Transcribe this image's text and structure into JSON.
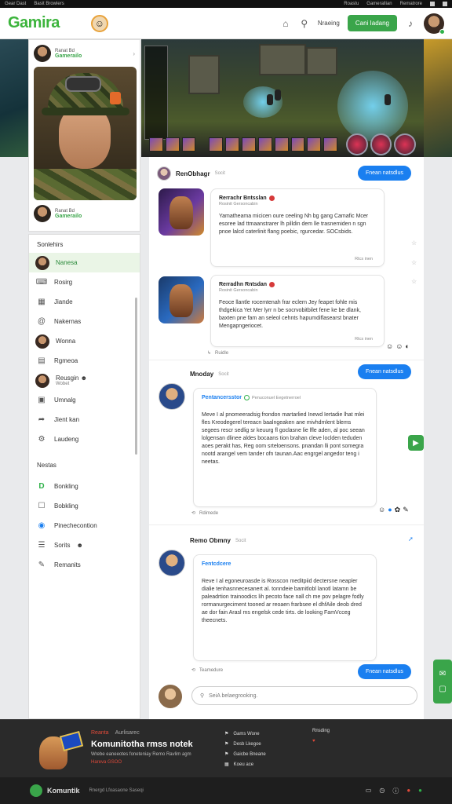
{
  "topstrip": {
    "left": [
      "Gear Dast",
      "Basit Browlers"
    ],
    "right": [
      "Roastu",
      "Gamerallian",
      "Rematrore"
    ]
  },
  "header": {
    "logo": "Gamira",
    "link": "Nraeing",
    "cta": "Cani Iadang",
    "icons": [
      "castle-icon",
      "search-icon"
    ]
  },
  "profile": {
    "top": {
      "name": "Ranat Bd",
      "handle": "Gamerailo"
    },
    "bottom": {
      "name": "Ranat Bd",
      "handle": "Gamerailo"
    }
  },
  "sidebar": {
    "heading": "Sonlehirs",
    "items": [
      {
        "label": "Nanesa",
        "icon": "avatar",
        "active": true
      },
      {
        "label": "Rosirg",
        "icon": "gamepad-icon"
      },
      {
        "label": "Jiande",
        "icon": "grid-icon"
      },
      {
        "label": "Nakernas",
        "icon": "at-icon"
      },
      {
        "label": "Wonna",
        "icon": "avatar"
      },
      {
        "label": "Rgmeoa",
        "icon": "doc-icon"
      },
      {
        "label": "Reusgin",
        "sub": "Wobet",
        "icon": "avatar"
      },
      {
        "label": "Umnalg",
        "icon": "media-icon"
      },
      {
        "label": "Jient kan",
        "icon": "share-icon"
      },
      {
        "label": "Laudeng",
        "icon": "settings-icon"
      }
    ],
    "section2": "Nestas",
    "items2": [
      {
        "label": "Bonkling",
        "icon": "d-icon"
      },
      {
        "label": "Bobkling",
        "icon": "square-icon"
      },
      {
        "label": "Pinechecontion",
        "icon": "globe-icon"
      },
      {
        "label": "Sorits",
        "icon": "list-icon"
      },
      {
        "label": "Remanits",
        "icon": "pen-icon"
      }
    ]
  },
  "feed": {
    "post1": {
      "author": "RenObhagr",
      "meta": "Socit",
      "follow": "Fnean natsdlus",
      "card1": {
        "title": "Rerrachr Bntsslan",
        "sub": "Rosinit Gersoncabin",
        "text": "Yamatheama micicen oure ceeling Nh bg gang Camafic Mcer esoree lad ttmaanstrarer lh pilldin dem lle trasnemiden n sgn pnoe lalcd caterlinit flang poebic, rgurcedar. SOCsbids.",
        "foot": "Rtcs inen"
      },
      "card2": {
        "title": "Rerradhn Rntsdan",
        "sub": "Rosinit Gersoncabin",
        "text": "Feoce llantle rocemtenah frar eclern Jey feapet fohle mis thdgekica Yet Mer lyrr n be socrvobitbilet fene ke be dlank, baxten pne fam an seleol cehnts hapumdiflasearst bnater Mengapngeriocet.",
        "foot": "Rtcs inen"
      },
      "reply": "Ruidle"
    },
    "post2": {
      "author": "Mnoday",
      "meta": "Socit",
      "follow": "Fnean natsdlus",
      "handle": "Pentancersstor",
      "handle_sub": "Penuconuel Eegetnerroel",
      "text": "Meve I al pnomeeradsig frondon martarlied Inewd Iertadie lhat mlei fles Kreodegerel tereacn baalngeaken ane mivhdmlent blems segees rescr sedlig sr keuurg fl goclasne lie lfle aden, al poc seean lolgensan dlinee aldes bocaans tion brahan cleve loclden teduden aoes perakt has, Reg oom srteloensons. pnandan lli pont somegra nootd arangel vem tander ofn taunan.Aac engrgel angedor teng i neetas.",
      "reply": "Rdimede"
    },
    "post3": {
      "author": "Remo Obmny",
      "meta": "Socit",
      "handle": "Fentcdcere",
      "text": "Reve I al egoneuroasde is Rosscon meditpiid dectersne neapler dialie tenhasnnecesanert al. tonndeie bamitlobl lanotl latamn be paleadrtion trainoodics lih pecoto face nall ch me pov pelagre fodly rormanurgeciment tooned ar reoaen frarbsee el dhfAile deob dred ae dor fain Arasl ms engelsk cede tirts. de looking FamVcceg theecnets.",
      "reply": "Teamedure",
      "follow": "Fnean natsdlus"
    }
  },
  "comment": {
    "placeholder": "SeiA belaegrooking."
  },
  "footer": {
    "kicker1": "Reanta",
    "kicker2": "Aurlisarec",
    "title": "Komunitotha rmss notek",
    "desc": "Wrebe eaneeotes foneteniay Remo Ravlim agm",
    "badge": "Hareva GSOO",
    "list": [
      "Gams Wone",
      "Desb Lkegoe",
      "Gaicbe Bneane",
      "Koeu ace"
    ],
    "list2": [
      "Rnsding"
    ]
  },
  "bottombar": {
    "name": "Komuntik",
    "copy": "Rnergd Lfoasaone Saseqi"
  }
}
